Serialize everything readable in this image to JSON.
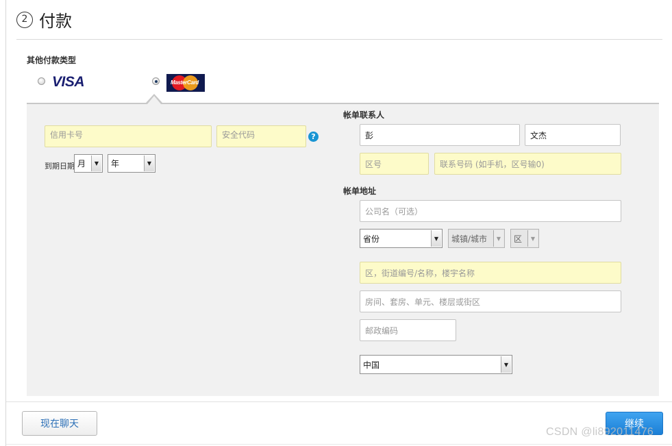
{
  "header": {
    "step_number": "2",
    "title": "付款"
  },
  "payment": {
    "other_types_label": "其他付款类型",
    "methods": [
      {
        "name": "VISA",
        "selected": false
      },
      {
        "name": "MasterCard",
        "selected": true
      }
    ]
  },
  "card": {
    "number_placeholder": "信用卡号",
    "cvv_placeholder": "安全代码",
    "help_glyph": "?",
    "expiry_label": "到期日期",
    "month_value": "月",
    "year_value": "年"
  },
  "contact": {
    "label": "帐单联系人",
    "last_name": "彭",
    "first_name": "文杰",
    "area_code_placeholder": "区号",
    "phone_placeholder": "联系号码 (如手机，区号输0)"
  },
  "address": {
    "label": "帐单地址",
    "company_placeholder": "公司名（可选）",
    "province_value": "省份",
    "city_value": "城镇/城市",
    "district_value": "区",
    "street_placeholder": "区，街道编号/名称，楼宇名称",
    "room_placeholder": "房间、套房、单元、楼层或街区",
    "postal_placeholder": "邮政编码",
    "country_value": "中国"
  },
  "footer": {
    "chat_label": "现在聊天",
    "continue_label": "继续"
  },
  "watermark": "CSDN @li892011476",
  "colors": {
    "required_field_bg": "#fdfbc9",
    "primary_button": "#1b7fd6",
    "help_icon": "#1a95d3",
    "panel_bg": "#f1f1f1"
  }
}
